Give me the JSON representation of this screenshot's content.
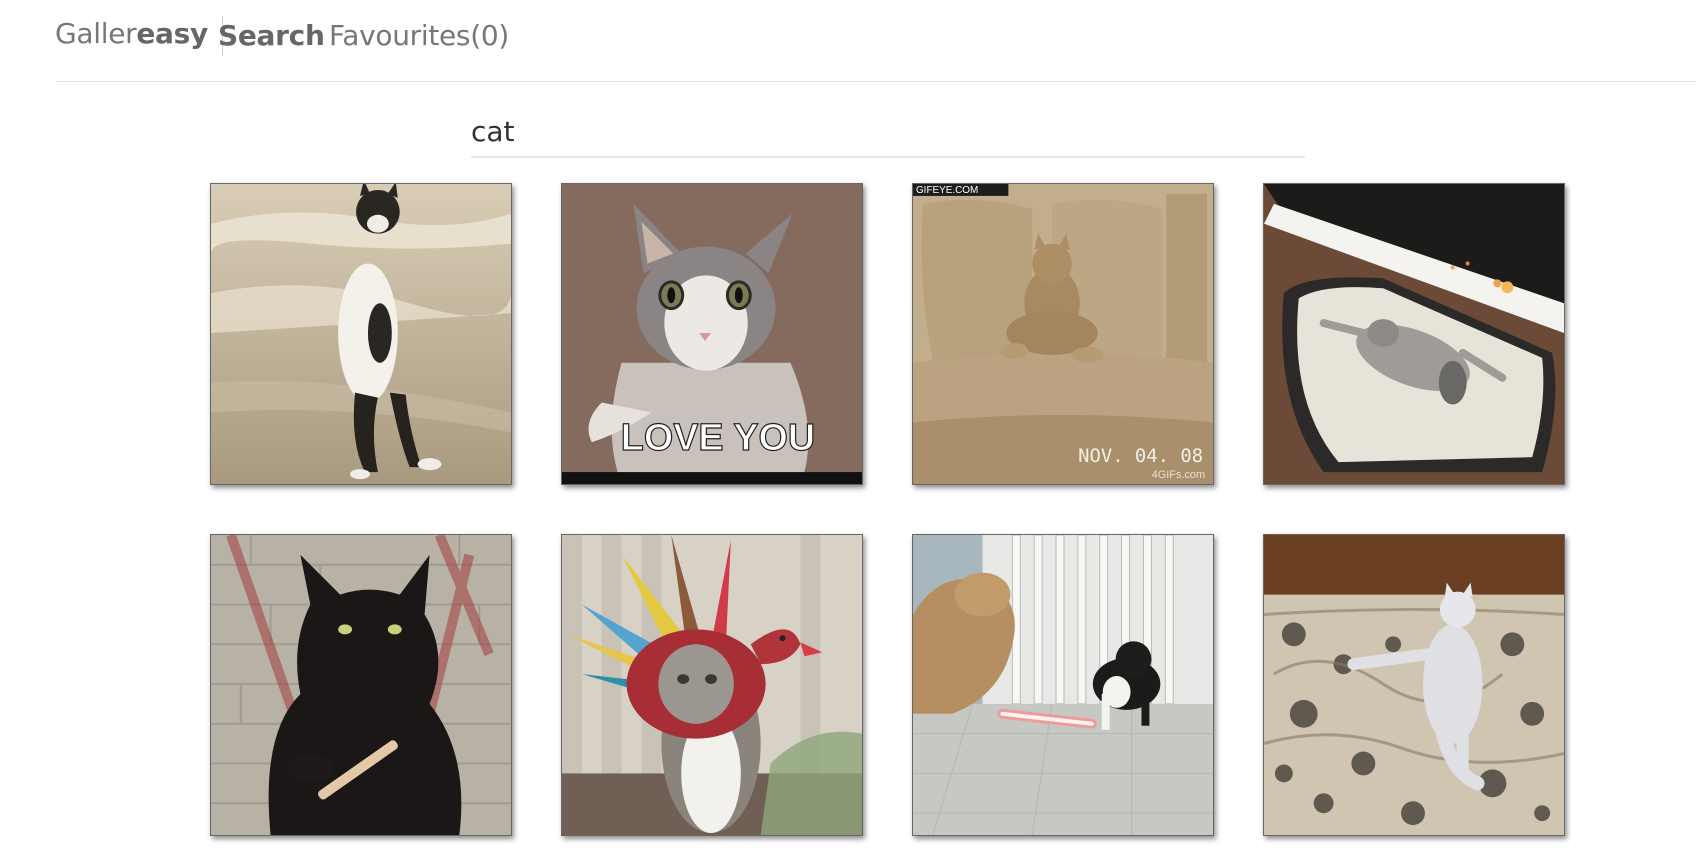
{
  "brand": {
    "light": "Galler",
    "bold": "easy"
  },
  "nav": {
    "search": "Search",
    "favourites": "Favourites(0)"
  },
  "search": {
    "value": "cat"
  },
  "results": [
    {
      "subject": "standing cat on snowy road",
      "caption": ""
    },
    {
      "subject": "grey and white cat",
      "caption": "LOVE YOU"
    },
    {
      "subject": "cat sitting on sofa",
      "caption": "NOV. 04. 08",
      "watermark_top": "GIFEYE.COM",
      "watermark_bottom": "4GIFs.com"
    },
    {
      "subject": "cat lying on bed by fireplace",
      "caption": ""
    },
    {
      "subject": "black cat with nail file",
      "caption": ""
    },
    {
      "subject": "cat in turkey costume",
      "caption": ""
    },
    {
      "subject": "cat with lightsaber and dog",
      "caption": ""
    },
    {
      "subject": "white cat standing on rug",
      "caption": ""
    }
  ]
}
